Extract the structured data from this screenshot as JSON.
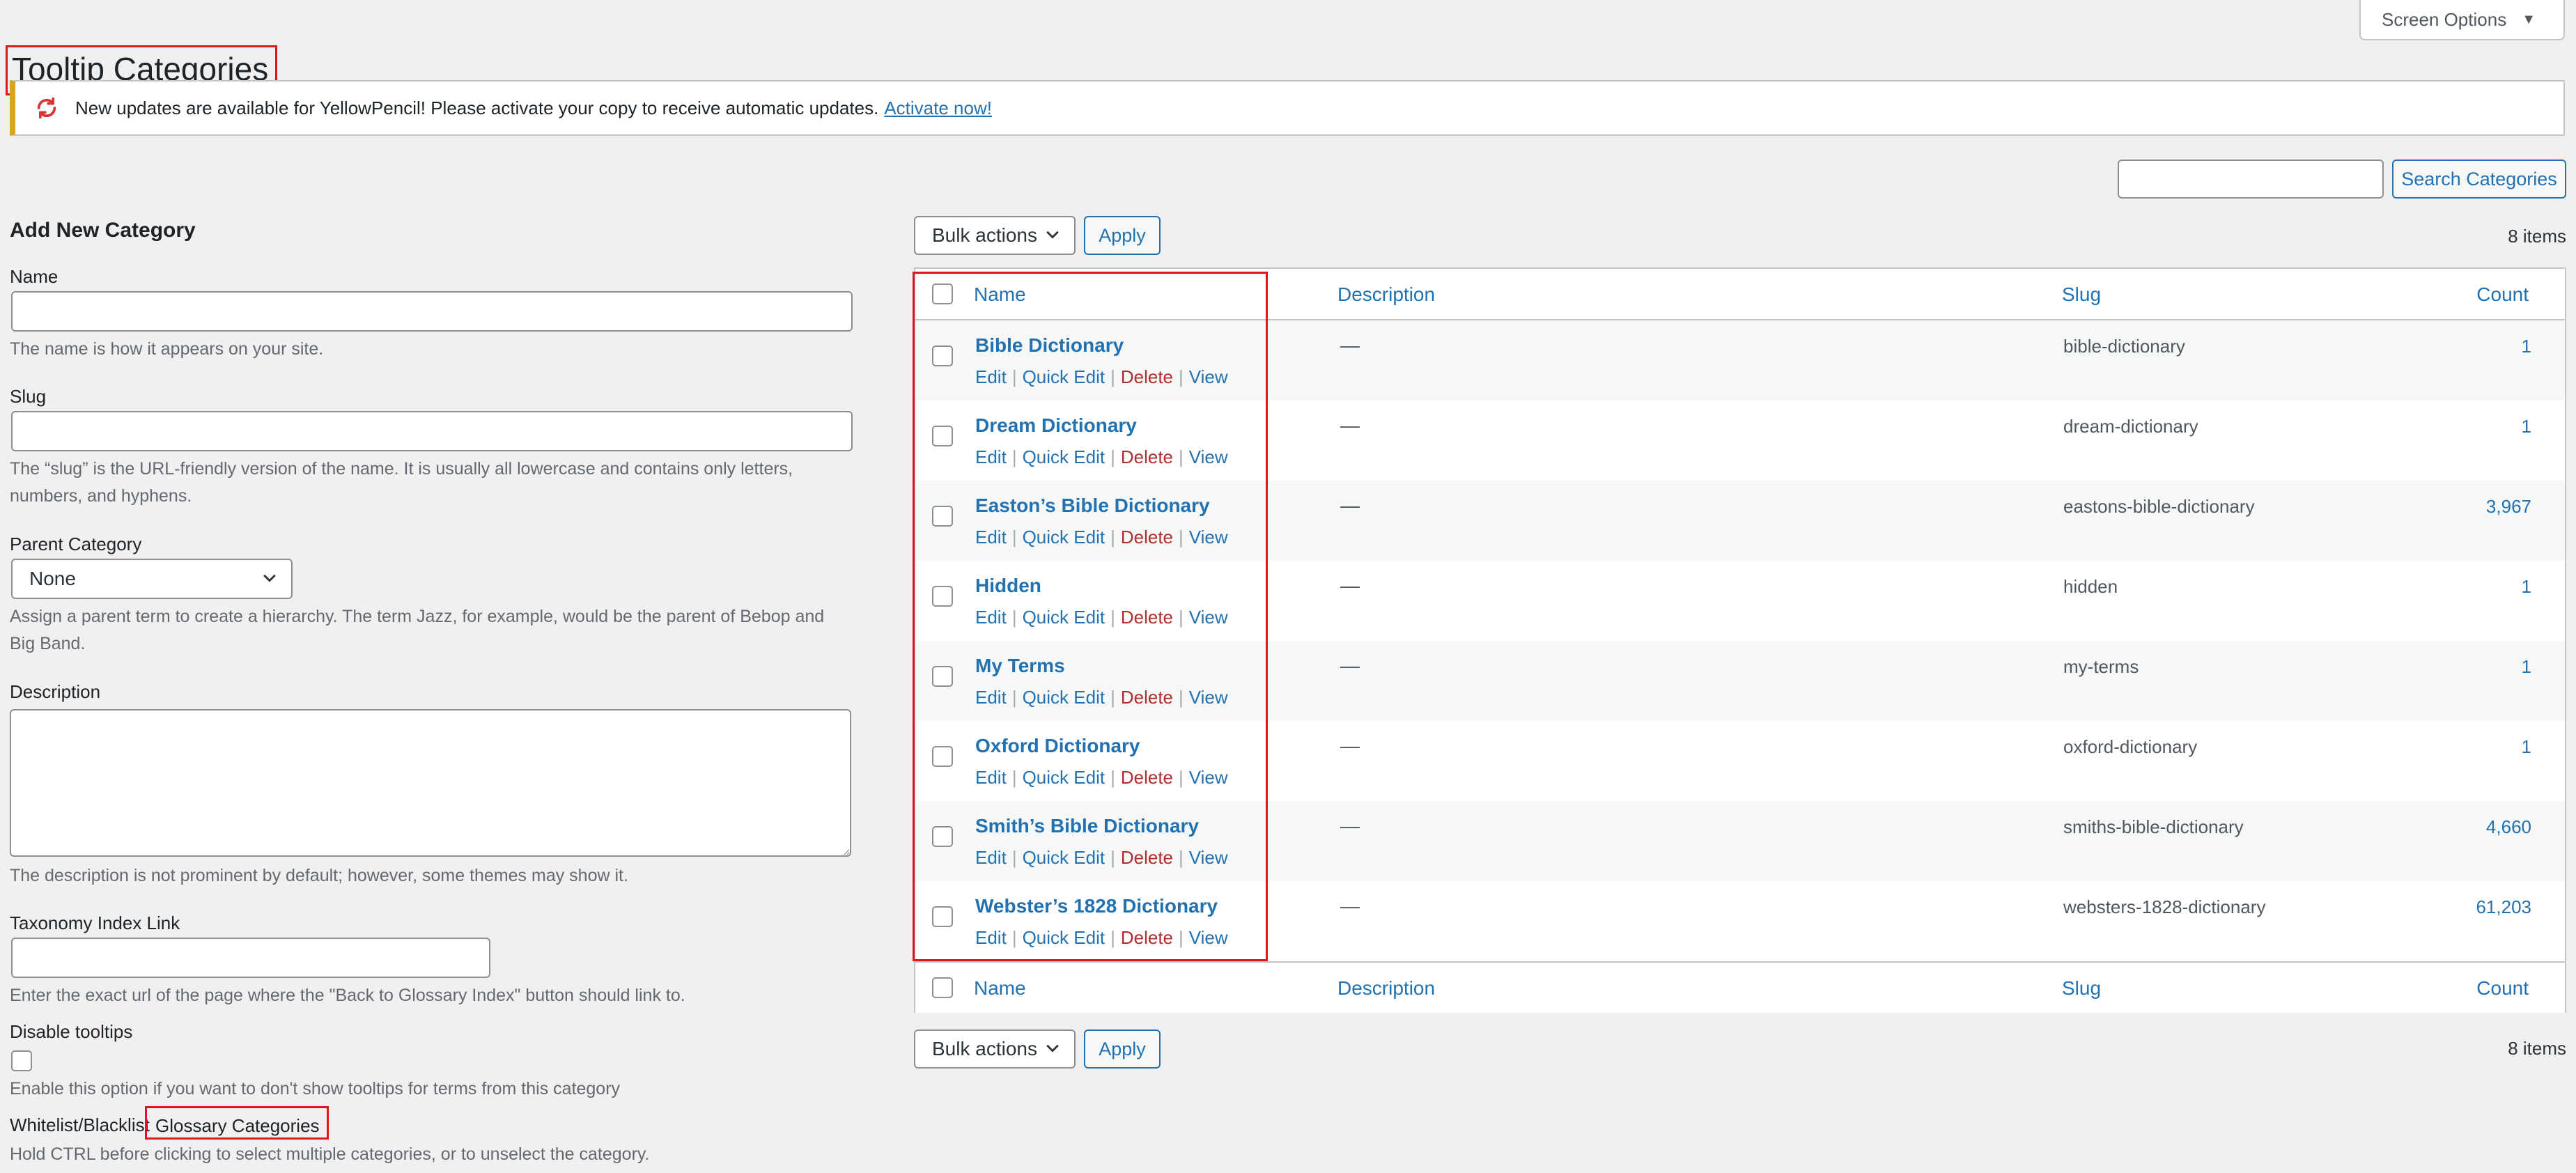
{
  "screen_options": {
    "label": "Screen Options"
  },
  "page": {
    "title": "Tooltip Categories"
  },
  "notice": {
    "text": "New updates are available for YellowPencil! Please activate your copy to receive automatic updates.",
    "link": "Activate now!"
  },
  "search": {
    "value": "",
    "button": "Search Categories"
  },
  "bulk": {
    "label": "Bulk actions",
    "apply": "Apply",
    "items_count": "8 items"
  },
  "form": {
    "heading": "Add New Category",
    "name_label": "Name",
    "name_help": "The name is how it appears on your site.",
    "slug_label": "Slug",
    "slug_help_1": "The “slug” is the URL-friendly version of the name. It is usually all lowercase and contains only letters,",
    "slug_help_2": "numbers, and hyphens.",
    "parent_label": "Parent Category",
    "parent_value": "None",
    "parent_help_1": "Assign a parent term to create a hierarchy. The term Jazz, for example, would be the parent of Bebop and",
    "parent_help_2": "Big Band.",
    "desc_label": "Description",
    "desc_help": "The description is not prominent by default; however, some themes may show it.",
    "tax_label": "Taxonomy Index Link",
    "tax_help": "Enter the exact url of the page where the \"Back to Glossary Index\" button should link to.",
    "disable_label": "Disable tooltips",
    "disable_help": "Enable this option if you want to don't show tooltips for terms from this category",
    "wl_label": "Whitelist/Blacklist",
    "wl_value": "Glossary Categories",
    "wl_help": "Hold CTRL before clicking to select multiple categories, or to unselect the category."
  },
  "table": {
    "columns": {
      "name": "Name",
      "description": "Description",
      "slug": "Slug",
      "count": "Count"
    },
    "actions": {
      "edit": "Edit",
      "quick_edit": "Quick Edit",
      "delete": "Delete",
      "view": "View"
    },
    "rows": [
      {
        "name": "Bible Dictionary",
        "description": "—",
        "slug": "bible-dictionary",
        "count": "1"
      },
      {
        "name": "Dream Dictionary",
        "description": "—",
        "slug": "dream-dictionary",
        "count": "1"
      },
      {
        "name": "Easton’s Bible Dictionary",
        "description": "—",
        "slug": "eastons-bible-dictionary",
        "count": "3,967"
      },
      {
        "name": "Hidden",
        "description": "—",
        "slug": "hidden",
        "count": "1"
      },
      {
        "name": "My Terms",
        "description": "—",
        "slug": "my-terms",
        "count": "1"
      },
      {
        "name": "Oxford Dictionary",
        "description": "—",
        "slug": "oxford-dictionary",
        "count": "1"
      },
      {
        "name": "Smith’s Bible Dictionary",
        "description": "—",
        "slug": "smiths-bible-dictionary",
        "count": "4,660"
      },
      {
        "name": "Webster’s 1828 Dictionary",
        "description": "—",
        "slug": "websters-1828-dictionary",
        "count": "61,203"
      }
    ]
  },
  "colors": {
    "link": "#2271b1",
    "delete": "#b32d2e",
    "highlight": "#e0161d",
    "notice_accent": "#dba617"
  }
}
